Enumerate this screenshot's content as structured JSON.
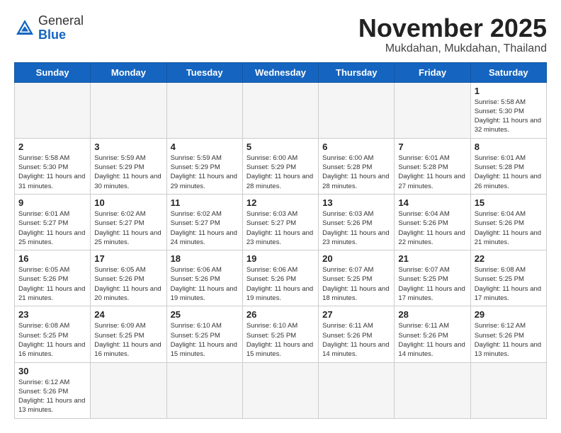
{
  "header": {
    "logo_general": "General",
    "logo_blue": "Blue",
    "month": "November 2025",
    "location": "Mukdahan, Mukdahan, Thailand"
  },
  "days_of_week": [
    "Sunday",
    "Monday",
    "Tuesday",
    "Wednesday",
    "Thursday",
    "Friday",
    "Saturday"
  ],
  "cells": [
    {
      "day": null,
      "info": ""
    },
    {
      "day": null,
      "info": ""
    },
    {
      "day": null,
      "info": ""
    },
    {
      "day": null,
      "info": ""
    },
    {
      "day": null,
      "info": ""
    },
    {
      "day": null,
      "info": ""
    },
    {
      "day": "1",
      "info": "Sunrise: 5:58 AM\nSunset: 5:30 PM\nDaylight: 11 hours\nand 32 minutes."
    },
    {
      "day": "2",
      "info": "Sunrise: 5:58 AM\nSunset: 5:30 PM\nDaylight: 11 hours\nand 31 minutes."
    },
    {
      "day": "3",
      "info": "Sunrise: 5:59 AM\nSunset: 5:29 PM\nDaylight: 11 hours\nand 30 minutes."
    },
    {
      "day": "4",
      "info": "Sunrise: 5:59 AM\nSunset: 5:29 PM\nDaylight: 11 hours\nand 29 minutes."
    },
    {
      "day": "5",
      "info": "Sunrise: 6:00 AM\nSunset: 5:29 PM\nDaylight: 11 hours\nand 28 minutes."
    },
    {
      "day": "6",
      "info": "Sunrise: 6:00 AM\nSunset: 5:28 PM\nDaylight: 11 hours\nand 28 minutes."
    },
    {
      "day": "7",
      "info": "Sunrise: 6:01 AM\nSunset: 5:28 PM\nDaylight: 11 hours\nand 27 minutes."
    },
    {
      "day": "8",
      "info": "Sunrise: 6:01 AM\nSunset: 5:28 PM\nDaylight: 11 hours\nand 26 minutes."
    },
    {
      "day": "9",
      "info": "Sunrise: 6:01 AM\nSunset: 5:27 PM\nDaylight: 11 hours\nand 25 minutes."
    },
    {
      "day": "10",
      "info": "Sunrise: 6:02 AM\nSunset: 5:27 PM\nDaylight: 11 hours\nand 25 minutes."
    },
    {
      "day": "11",
      "info": "Sunrise: 6:02 AM\nSunset: 5:27 PM\nDaylight: 11 hours\nand 24 minutes."
    },
    {
      "day": "12",
      "info": "Sunrise: 6:03 AM\nSunset: 5:27 PM\nDaylight: 11 hours\nand 23 minutes."
    },
    {
      "day": "13",
      "info": "Sunrise: 6:03 AM\nSunset: 5:26 PM\nDaylight: 11 hours\nand 23 minutes."
    },
    {
      "day": "14",
      "info": "Sunrise: 6:04 AM\nSunset: 5:26 PM\nDaylight: 11 hours\nand 22 minutes."
    },
    {
      "day": "15",
      "info": "Sunrise: 6:04 AM\nSunset: 5:26 PM\nDaylight: 11 hours\nand 21 minutes."
    },
    {
      "day": "16",
      "info": "Sunrise: 6:05 AM\nSunset: 5:26 PM\nDaylight: 11 hours\nand 21 minutes."
    },
    {
      "day": "17",
      "info": "Sunrise: 6:05 AM\nSunset: 5:26 PM\nDaylight: 11 hours\nand 20 minutes."
    },
    {
      "day": "18",
      "info": "Sunrise: 6:06 AM\nSunset: 5:26 PM\nDaylight: 11 hours\nand 19 minutes."
    },
    {
      "day": "19",
      "info": "Sunrise: 6:06 AM\nSunset: 5:26 PM\nDaylight: 11 hours\nand 19 minutes."
    },
    {
      "day": "20",
      "info": "Sunrise: 6:07 AM\nSunset: 5:25 PM\nDaylight: 11 hours\nand 18 minutes."
    },
    {
      "day": "21",
      "info": "Sunrise: 6:07 AM\nSunset: 5:25 PM\nDaylight: 11 hours\nand 17 minutes."
    },
    {
      "day": "22",
      "info": "Sunrise: 6:08 AM\nSunset: 5:25 PM\nDaylight: 11 hours\nand 17 minutes."
    },
    {
      "day": "23",
      "info": "Sunrise: 6:08 AM\nSunset: 5:25 PM\nDaylight: 11 hours\nand 16 minutes."
    },
    {
      "day": "24",
      "info": "Sunrise: 6:09 AM\nSunset: 5:25 PM\nDaylight: 11 hours\nand 16 minutes."
    },
    {
      "day": "25",
      "info": "Sunrise: 6:10 AM\nSunset: 5:25 PM\nDaylight: 11 hours\nand 15 minutes."
    },
    {
      "day": "26",
      "info": "Sunrise: 6:10 AM\nSunset: 5:25 PM\nDaylight: 11 hours\nand 15 minutes."
    },
    {
      "day": "27",
      "info": "Sunrise: 6:11 AM\nSunset: 5:26 PM\nDaylight: 11 hours\nand 14 minutes."
    },
    {
      "day": "28",
      "info": "Sunrise: 6:11 AM\nSunset: 5:26 PM\nDaylight: 11 hours\nand 14 minutes."
    },
    {
      "day": "29",
      "info": "Sunrise: 6:12 AM\nSunset: 5:26 PM\nDaylight: 11 hours\nand 13 minutes."
    },
    {
      "day": "30",
      "info": "Sunrise: 6:12 AM\nSunset: 5:26 PM\nDaylight: 11 hours\nand 13 minutes."
    },
    {
      "day": null,
      "info": ""
    },
    {
      "day": null,
      "info": ""
    },
    {
      "day": null,
      "info": ""
    },
    {
      "day": null,
      "info": ""
    },
    {
      "day": null,
      "info": ""
    },
    {
      "day": null,
      "info": ""
    }
  ]
}
